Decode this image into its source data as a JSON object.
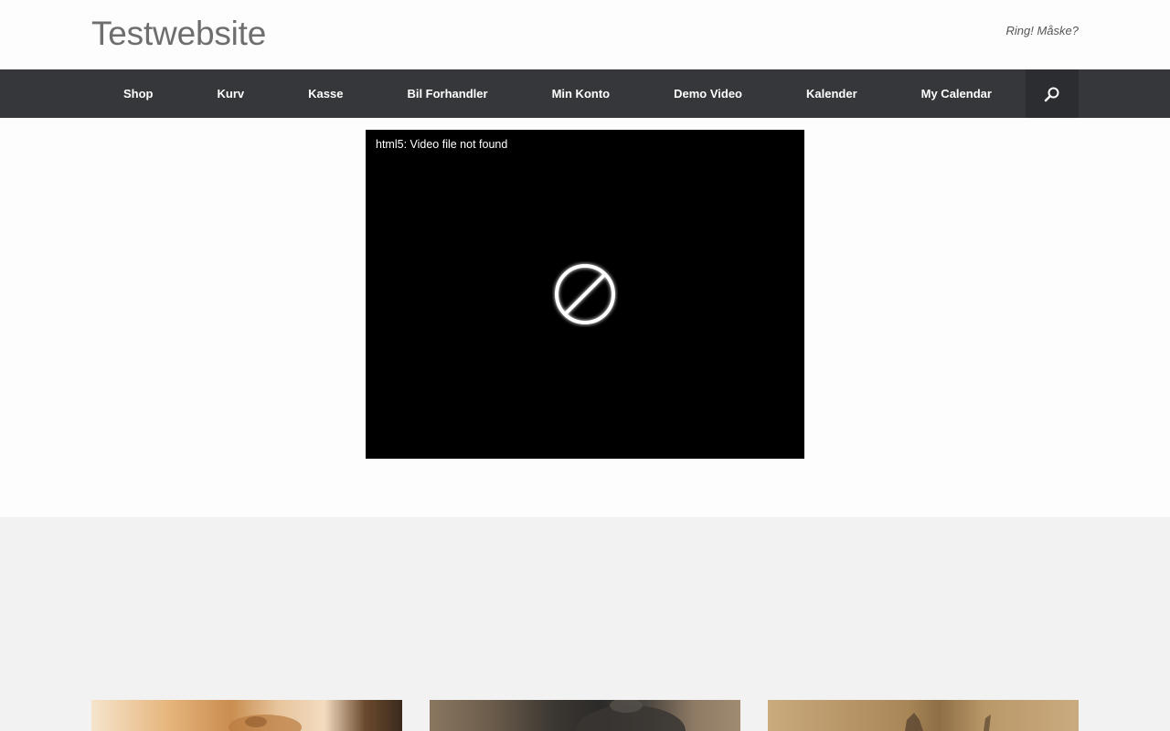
{
  "site": {
    "title": "Testwebsite",
    "tagline": "Ring! Måske?"
  },
  "nav": {
    "items": [
      {
        "label": "Shop"
      },
      {
        "label": "Kurv"
      },
      {
        "label": "Kasse"
      },
      {
        "label": "Bil Forhandler"
      },
      {
        "label": "Min Konto"
      },
      {
        "label": "Demo Video"
      },
      {
        "label": "Kalender"
      },
      {
        "label": "My Calendar"
      }
    ],
    "search_icon": "search-icon"
  },
  "video": {
    "error_text": "html5: Video file not found",
    "icon": "no-entry-icon"
  },
  "thumbnails": [
    {
      "icon": "lion-photo"
    },
    {
      "icon": "rhino-photo"
    },
    {
      "icon": "antelope-photo"
    }
  ],
  "colors": {
    "nav_bg": "#35373a",
    "nav_search_bg": "#2b2d30",
    "page_bg": "#fdfdfd",
    "band_bg": "#f2f2f2",
    "video_bg": "#000000"
  }
}
